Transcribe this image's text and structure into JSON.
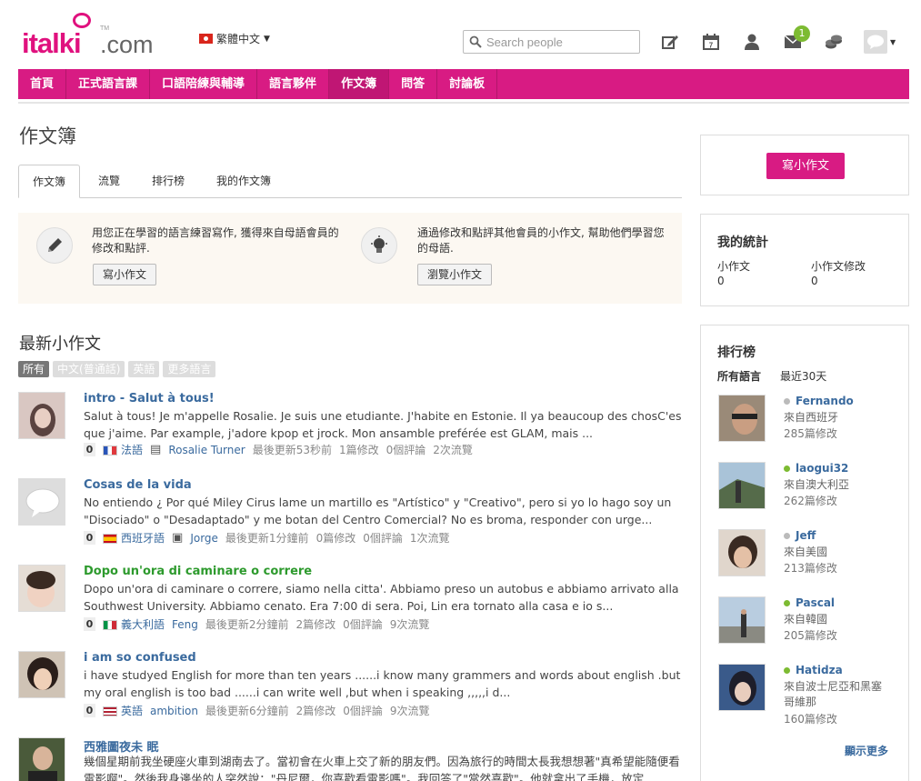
{
  "brand": {
    "logo_main": "italki",
    "logo_tld": ".com",
    "logo_tm": "TM"
  },
  "header": {
    "language": "繁體中文",
    "search_placeholder": "Search people",
    "notification_count": "1",
    "calendar_day": "7"
  },
  "nav": [
    "首頁",
    "正式語言課",
    "口語陪練與輔導",
    "語言夥伴",
    "作文簿",
    "問答",
    "討論板"
  ],
  "page": {
    "title": "作文簿"
  },
  "tabs": [
    "作文簿",
    "流覽",
    "排行榜",
    "我的作文簿"
  ],
  "promo": {
    "write_text": "用您正在學習的語言練習寫作, 獲得來自母語會員的修改和點評.",
    "write_button": "寫小作文",
    "browse_text": "通過修改和點評其他會員的小作文, 幫助他們學習您的母語.",
    "browse_button": "瀏覽小作文"
  },
  "latest": {
    "heading": "最新小作文",
    "filters": [
      "所有",
      "中文(普通話)",
      "英語",
      "更多語言"
    ],
    "entries": [
      {
        "title": "intro - Salut à tous!",
        "excerpt": "Salut à tous! Je m'appelle Rosalie. Je suis une etudiante. J'habite en Estonie. Il ya beaucoup des chosC'es que j'aime. Par example, j'adore kpop et jrock. Mon ansamble preférée est GLAM, mais ...",
        "count": "0",
        "language": "法語",
        "device": "▤",
        "user": "Rosalie Turner",
        "updated": "最後更新53秒前",
        "corrections": "1篇修改",
        "comments": "0個評論",
        "views": "2次流覽"
      },
      {
        "title": "Cosas de la vida",
        "excerpt": "No entiendo ¿ Por qué Miley Cirus lame un martillo es \"Artístico\" y \"Creativo\", pero si yo lo hago soy un \"Disociado\" o \"Desadaptado\" y me botan del Centro Comercial? No es broma, responder con urge...",
        "count": "0",
        "language": "西班牙語",
        "device": "▣",
        "user": "Jorge",
        "updated": "最後更新1分鐘前",
        "corrections": "0篇修改",
        "comments": "0個評論",
        "views": "1次流覽"
      },
      {
        "title": "Dopo un'ora di caminare o correre",
        "excerpt": "Dopo un'ora di caminare o correre, siamo nella citta'. Abbiamo preso un autobus e abbiamo arrivato alla Southwest University. Abbiamo cenato. Era 7:00 di sera. Poi, Lin era tornato alla casa e io s...",
        "count": "0",
        "language": "義大利語",
        "device": "",
        "user": "Feng",
        "updated": "最後更新2分鐘前",
        "corrections": "2篇修改",
        "comments": "0個評論",
        "views": "9次流覽"
      },
      {
        "title": "i am so confused",
        "excerpt": "i have studyed English for more than ten years ......i know many grammers and words about english .but my oral english is too bad ......i can write well ,but when i speaking ,,,,,i d...",
        "count": "0",
        "language": "英語",
        "device": "",
        "user": "ambition",
        "updated": "最後更新6分鐘前",
        "corrections": "2篇修改",
        "comments": "0個評論",
        "views": "9次流覽"
      },
      {
        "title": "西雅圖夜未 眠",
        "excerpt": "幾個星期前我坐硬座火車到湖南去了。當初會在火車上交了新的朋友們。因為旅行的時間太長我想想著\"真希望能隨便看電影啊\"。然後我身邊坐的人突然說：\"丹尼爾，你喜歡看電影嗎\"。我回答了\"當然喜歡\"。他就拿出了手機，放定",
        "count": "",
        "language": "",
        "device": "",
        "user": "",
        "updated": "",
        "corrections": "",
        "comments": "",
        "views": ""
      }
    ]
  },
  "sidebar": {
    "write_button": "寫小作文",
    "stats": {
      "heading": "我的統計",
      "essays_label": "小作文",
      "essays_value": "0",
      "corrections_label": "小作文修改",
      "corrections_value": "0"
    },
    "ranking": {
      "heading": "排行榜",
      "filter_lang": "所有語言",
      "filter_time": "最近30天",
      "more": "顯示更多",
      "users": [
        {
          "name": "Fernando",
          "from": "來自西班牙",
          "count": "285篇修改",
          "online": false
        },
        {
          "name": "laogui32",
          "from": "來自澳大利亞",
          "count": "262篇修改",
          "online": true
        },
        {
          "name": "Jeff",
          "from": "來自美國",
          "count": "213篇修改",
          "online": false
        },
        {
          "name": "Pascal",
          "from": "來自韓國",
          "count": "205篇修改",
          "online": true
        },
        {
          "name": "Hatidza",
          "from": "來自波士尼亞和黑塞哥維那",
          "count": "160篇修改",
          "online": true
        }
      ]
    }
  },
  "colors": {
    "brand": "#d81b83",
    "link": "#3a6a9e",
    "green": "#2d9a2d",
    "online": "#7dbb32"
  }
}
